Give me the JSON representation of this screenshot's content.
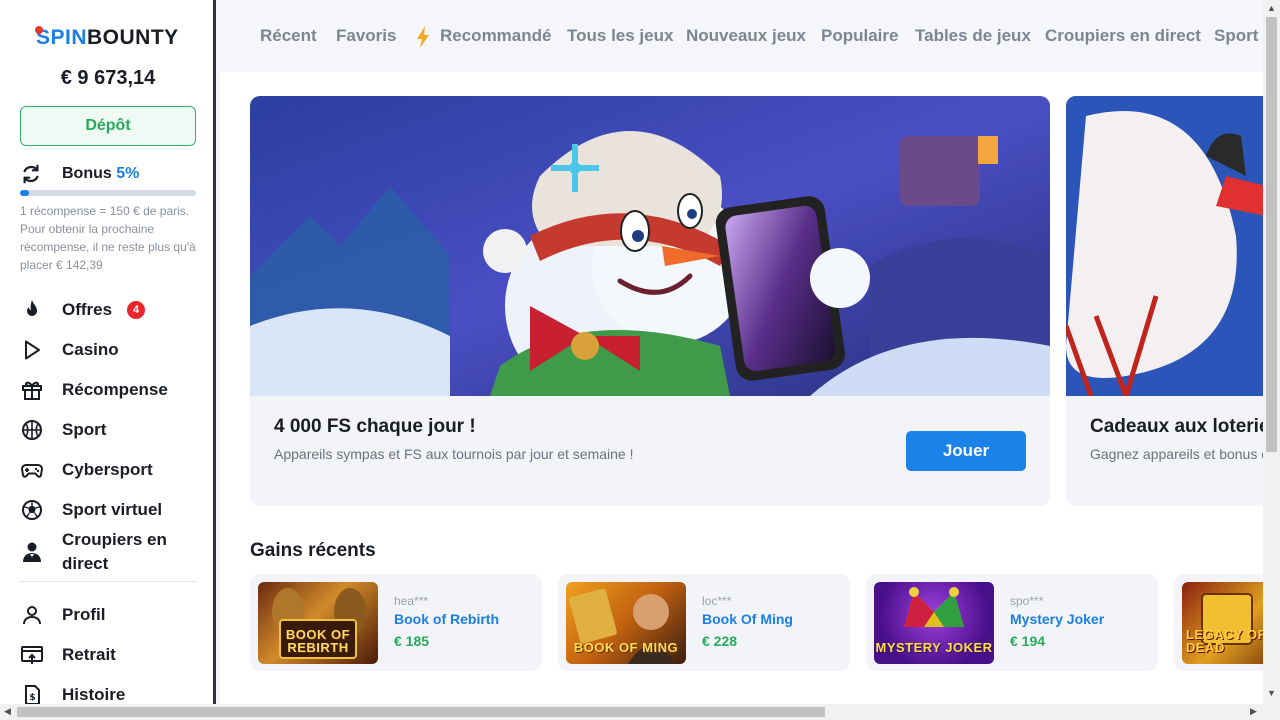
{
  "brand": {
    "part1": "SPIN",
    "part2": "BOUNTY"
  },
  "account": {
    "balance": "€ 9 673,14",
    "deposit_label": "Dépôt"
  },
  "bonus": {
    "label": "Bonus",
    "percent": "5%",
    "progress_fraction": 0.05,
    "note": "1 récompense = 150 € de paris. Pour obtenir la prochaine récompense, il ne reste plus qu'à placer € 142,39"
  },
  "sidebar": {
    "items": [
      {
        "label": "Offres",
        "icon": "fire-icon",
        "badge": "4"
      },
      {
        "label": "Casino",
        "icon": "play-icon"
      },
      {
        "label": "Récompense",
        "icon": "gift-icon"
      },
      {
        "label": "Sport",
        "icon": "basketball-icon"
      },
      {
        "label": "Cybersport",
        "icon": "gamepad-icon"
      },
      {
        "label": "Sport virtuel",
        "icon": "virtual-ball-icon"
      },
      {
        "label": "Croupiers en direct",
        "icon": "dealer-icon"
      }
    ],
    "account_items": [
      {
        "label": "Profil",
        "icon": "user-icon"
      },
      {
        "label": "Retrait",
        "icon": "withdraw-icon"
      },
      {
        "label": "Histoire",
        "icon": "history-icon"
      }
    ]
  },
  "tabs": [
    "Récent",
    "Favoris",
    "Recommandé",
    "Tous les jeux",
    "Nouveaux jeux",
    "Populaire",
    "Tables de jeux",
    "Croupiers en direct",
    "Sport virtuel"
  ],
  "promos": [
    {
      "title": "4 000 FS chaque jour !",
      "subtitle": "Appareils sympas et FS aux tournois par jour et semaine !",
      "button": "Jouer"
    },
    {
      "title": "Cadeaux aux loteries",
      "subtitle": "Gagnez appareils et bonus chaque semaine !"
    }
  ],
  "recent_wins": {
    "title": "Gains récents",
    "items": [
      {
        "user": "hea***",
        "game": "Book of Rebirth",
        "amount": "€ 185",
        "thumb_text": "BOOK OF REBIRTH"
      },
      {
        "user": "loc***",
        "game": "Book Of Ming",
        "amount": "€ 228",
        "thumb_text": "BOOK OF MING"
      },
      {
        "user": "spo***",
        "game": "Mystery Joker",
        "amount": "€ 194",
        "thumb_text": "MYSTERY JOKER"
      },
      {
        "user": "",
        "game": "",
        "amount": "",
        "thumb_text": "LEGACY OF DEAD"
      }
    ]
  },
  "colors": {
    "accent": "#1b7fe6",
    "success": "#2aa85e",
    "badge": "#e8262b"
  }
}
